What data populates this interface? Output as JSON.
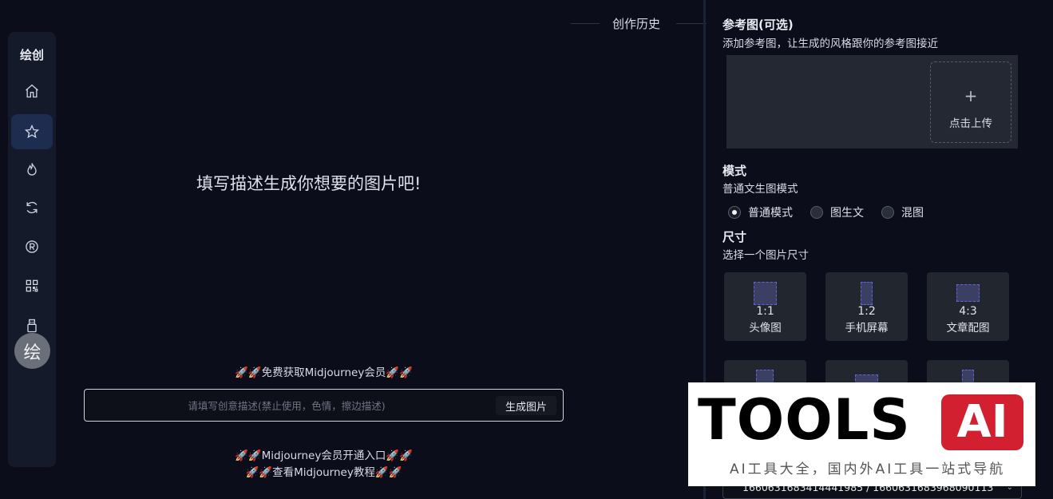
{
  "sidebar": {
    "title": "绘创",
    "avatar_text": "绘"
  },
  "history": {
    "title": "创作历史"
  },
  "main": {
    "hint": "填写描述生成你想要的图片吧!",
    "promo_top": "🚀🚀免费获取Midjourney会员🚀🚀",
    "prompt_placeholder": "请填写创意描述(禁止使用，色情，擦边描述)",
    "generate_button": "生成图片",
    "promo_bottom_1": "🚀🚀Midjourney会员开通入口🚀🚀",
    "promo_bottom_2": "🚀🚀查看Midjourney教程🚀🚀"
  },
  "right_panel": {
    "reference": {
      "title": "参考图(可选)",
      "subtitle": "添加参考图，让生成的风格跟你的参考图接近",
      "upload_plus": "+",
      "upload_label": "点击上传"
    },
    "mode": {
      "title": "模式",
      "subtitle": "普通文生图模式",
      "options": [
        {
          "label": "普通模式",
          "checked": true
        },
        {
          "label": "图生文",
          "checked": false
        },
        {
          "label": "混图",
          "checked": false
        }
      ]
    },
    "size": {
      "title": "尺寸",
      "subtitle": "选择一个图片尺寸",
      "options": [
        {
          "ratio": "1:1",
          "name": "头像图"
        },
        {
          "ratio": "1:2",
          "name": "手机屏幕"
        },
        {
          "ratio": "4:3",
          "name": "文章配图"
        }
      ]
    },
    "seed_value": "1660631683414441985 / 1660631683968090113"
  },
  "watermark": {
    "brand": "TOOLS",
    "badge": "AI",
    "slogan": "AI工具大全，国内外AI工具一站式导航"
  }
}
